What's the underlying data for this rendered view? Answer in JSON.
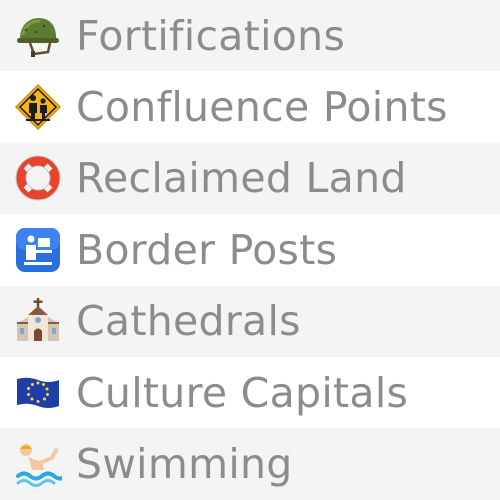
{
  "list": {
    "items": [
      {
        "label": "Fortifications",
        "icon": "military-helmet-icon"
      },
      {
        "label": "Confluence Points",
        "icon": "children-crossing-icon"
      },
      {
        "label": "Reclaimed Land",
        "icon": "ring-buoy-icon"
      },
      {
        "label": "Border Posts",
        "icon": "passport-control-icon"
      },
      {
        "label": "Cathedrals",
        "icon": "church-icon"
      },
      {
        "label": "Culture Capitals",
        "icon": "eu-flag-icon"
      },
      {
        "label": "Swimming",
        "icon": "swimmer-icon"
      }
    ]
  }
}
